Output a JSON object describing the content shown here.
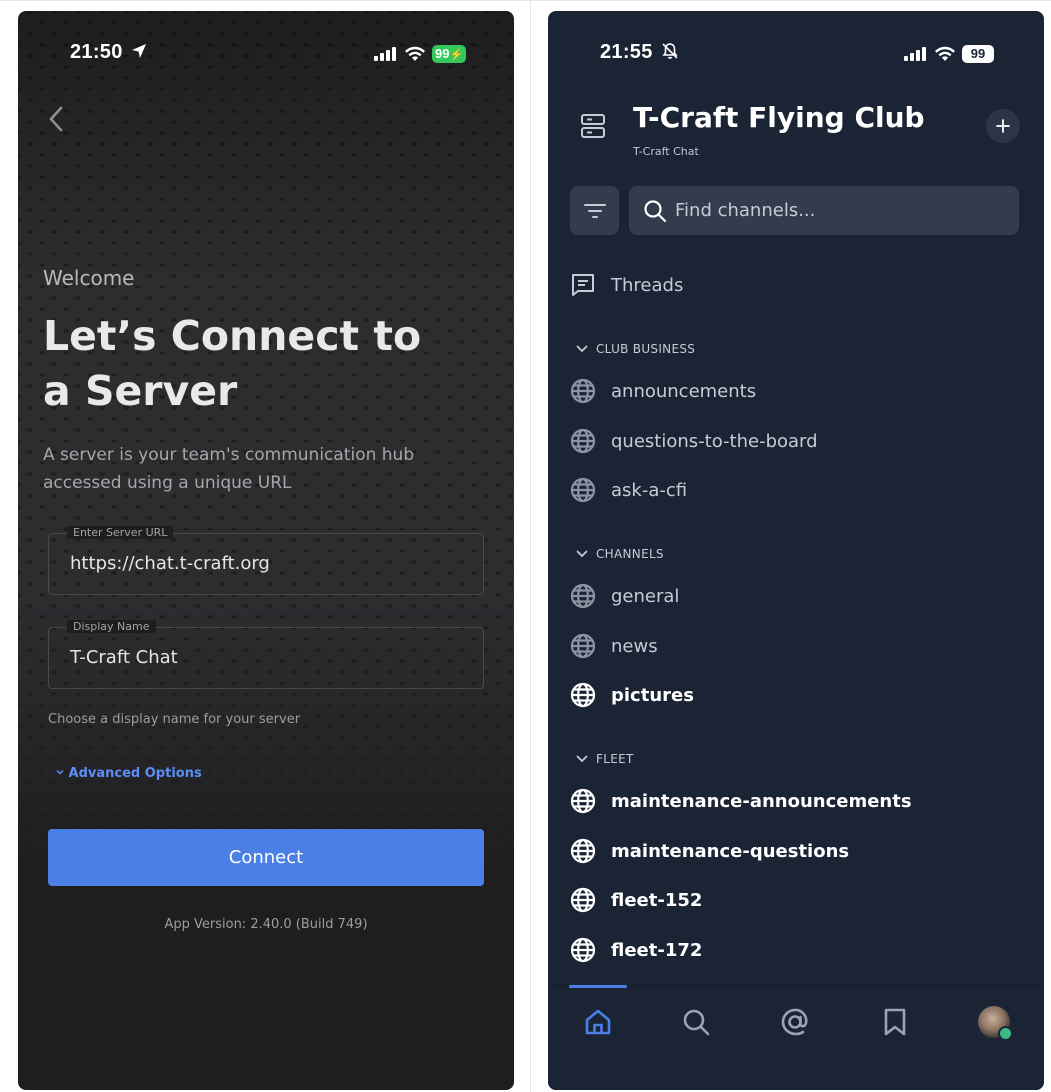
{
  "left": {
    "status": {
      "time": "21:50",
      "battery": "99"
    },
    "welcome": "Welcome",
    "headline": "Let’s Connect to a Server",
    "subtitle": "A server is your team's communication hub accessed using a unique URL",
    "server_url": {
      "label": "Enter Server URL",
      "value": "https://chat.t-craft.org"
    },
    "display_name": {
      "label": "Display Name",
      "value": "T-Craft Chat"
    },
    "hint": "Choose a display name for your server",
    "advanced_options": "Advanced Options",
    "connect_label": "Connect",
    "app_version": "App Version: 2.40.0 (Build 749)",
    "colors": {
      "accent": "#4a7fe6",
      "link": "#5d8ef5",
      "battery": "#34c759"
    }
  },
  "right": {
    "status": {
      "time": "21:55",
      "battery": "99"
    },
    "team_name": "T-Craft Flying Club",
    "server_name": "T-Craft Chat",
    "search_placeholder": "Find channels...",
    "threads_label": "Threads",
    "sections": [
      {
        "title": "CLUB BUSINESS",
        "channels": [
          {
            "name": "announcements",
            "unread": false
          },
          {
            "name": "questions-to-the-board",
            "unread": false
          },
          {
            "name": "ask-a-cfi",
            "unread": false
          }
        ]
      },
      {
        "title": "CHANNELS",
        "channels": [
          {
            "name": "general",
            "unread": false
          },
          {
            "name": "news",
            "unread": false
          },
          {
            "name": "pictures",
            "unread": true
          }
        ]
      },
      {
        "title": "FLEET",
        "channels": [
          {
            "name": "maintenance-announcements",
            "unread": true
          },
          {
            "name": "maintenance-questions",
            "unread": true
          },
          {
            "name": "fleet-152",
            "unread": true
          },
          {
            "name": "fleet-172",
            "unread": true
          }
        ]
      }
    ],
    "tabs": [
      "home-icon",
      "search-icon",
      "mention-icon",
      "bookmark-icon",
      "avatar"
    ],
    "colors": {
      "background": "#1b2434",
      "accent": "#4a7fe6",
      "online": "#3db887"
    }
  }
}
